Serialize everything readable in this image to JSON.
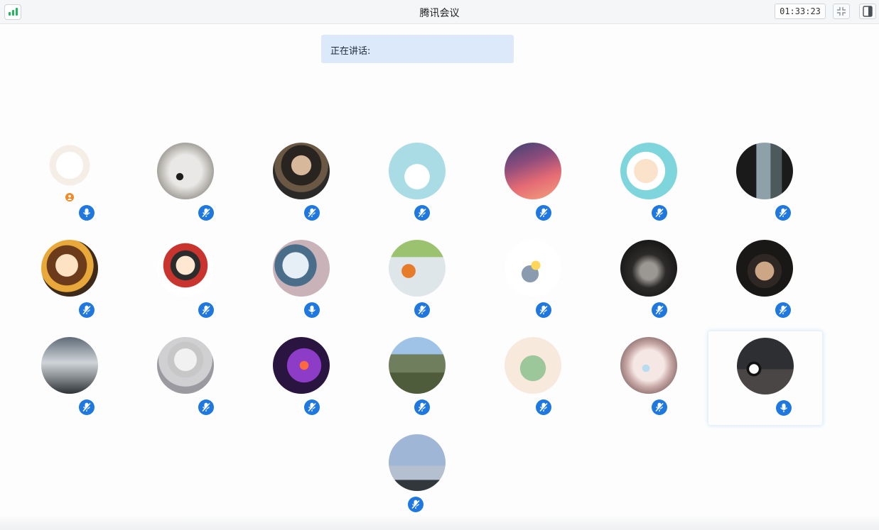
{
  "titlebar": {
    "title": "腾讯会议",
    "timer": "01:33:23",
    "signal_color": "#1fb85a"
  },
  "banner": {
    "speaking_label": "正在讲话:"
  },
  "icons": {
    "mic": "microphone-icon",
    "host": "host-badge-icon",
    "signal": "signal-bars-icon",
    "exit_fullscreen": "exit-fullscreen-icon",
    "side_panel": "side-panel-icon"
  },
  "colors": {
    "mic_blue": "#1f78e0",
    "banner_bg": "#dbe9fa",
    "host_orange": "#f08a24"
  },
  "participants": [
    {
      "avatar": "cat-cartoon",
      "mic_state": "unmuted-idle",
      "host": true
    },
    {
      "avatar": "puppy-photo",
      "mic_state": "muted"
    },
    {
      "avatar": "young-man-photo",
      "mic_state": "muted"
    },
    {
      "avatar": "duck-cartoon",
      "mic_state": "muted"
    },
    {
      "avatar": "pink-sunset",
      "mic_state": "muted"
    },
    {
      "avatar": "boy-cartoon",
      "mic_state": "muted"
    },
    {
      "avatar": "silhouette-window",
      "mic_state": "muted"
    },
    {
      "avatar": "sunflower-girl-cartoon",
      "mic_state": "muted"
    },
    {
      "avatar": "chibi-red-cartoon",
      "mic_state": "muted"
    },
    {
      "avatar": "winter-child-photo",
      "mic_state": "unmuted-idle"
    },
    {
      "avatar": "fishing-person-photo",
      "mic_state": "muted"
    },
    {
      "avatar": "donkey-doodle",
      "mic_state": "muted"
    },
    {
      "avatar": "dark-face-photo",
      "mic_state": "muted"
    },
    {
      "avatar": "bearded-man-photo",
      "mic_state": "muted"
    },
    {
      "avatar": "cloudy-sky-photo",
      "mic_state": "muted"
    },
    {
      "avatar": "anime-white-hair",
      "mic_state": "muted"
    },
    {
      "avatar": "anime-purple",
      "mic_state": "muted"
    },
    {
      "avatar": "lake-landscape",
      "mic_state": "muted"
    },
    {
      "avatar": "green-dino-cartoon",
      "mic_state": "muted"
    },
    {
      "avatar": "fluffy-dog-photo",
      "mic_state": "muted"
    },
    {
      "avatar": "panda-desk-photo",
      "mic_state": "unmuted-idle",
      "active": true
    },
    {
      "avatar": "evening-sky-photo",
      "mic_state": "muted"
    }
  ]
}
